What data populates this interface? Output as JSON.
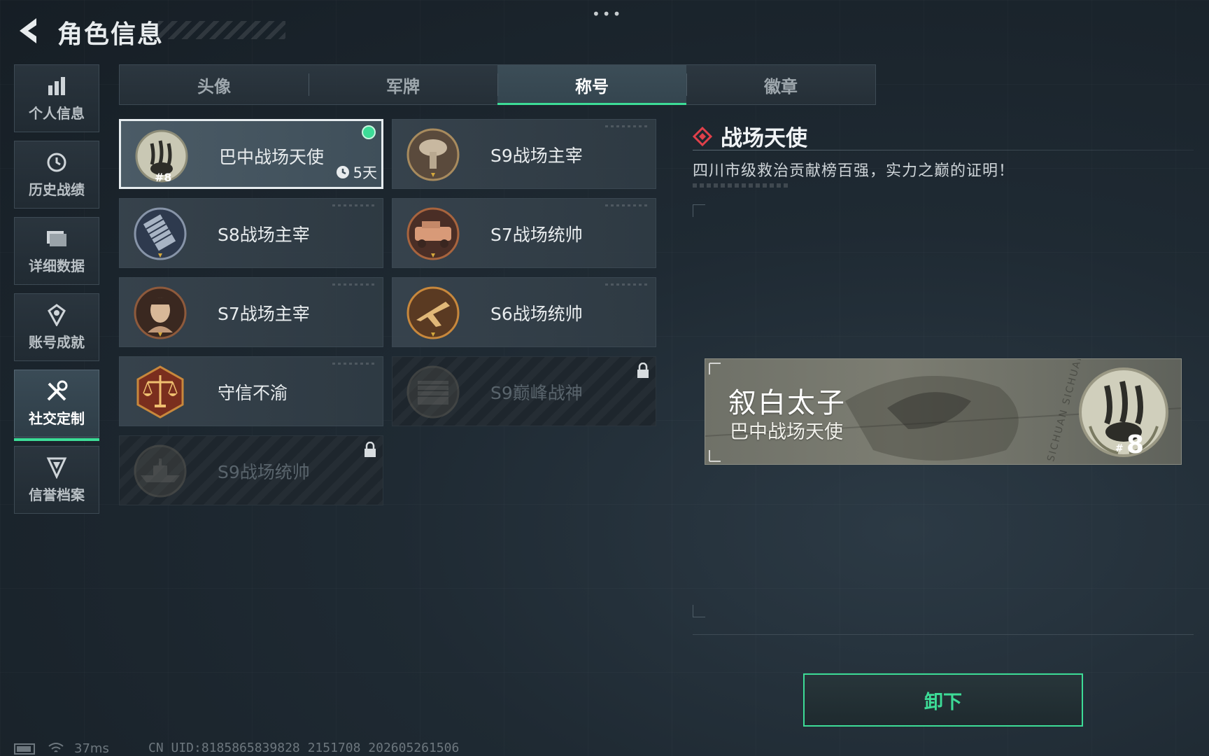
{
  "header": {
    "title": "角色信息"
  },
  "sidebar": {
    "items": [
      {
        "label": "个人信息",
        "icon": "bar-chart-icon"
      },
      {
        "label": "历史战绩",
        "icon": "history-clock-icon"
      },
      {
        "label": "详细数据",
        "icon": "folder-icon"
      },
      {
        "label": "账号成就",
        "icon": "achievement-icon"
      },
      {
        "label": "社交定制",
        "icon": "tools-icon",
        "active": true
      },
      {
        "label": "信誉档案",
        "icon": "shield-badge-icon"
      }
    ]
  },
  "tabs": [
    {
      "label": "头像"
    },
    {
      "label": "军牌"
    },
    {
      "label": "称号",
      "active": true
    },
    {
      "label": "徽章"
    }
  ],
  "titles": [
    {
      "name": "巴中战场天使",
      "selected": true,
      "equipped": true,
      "timer": "5天",
      "emblem": "sichuan-panda-emblem",
      "rank": "#8"
    },
    {
      "name": "S9战场主宰",
      "emblem": "mushroom-cloud-emblem"
    },
    {
      "name": "S8战场主宰",
      "emblem": "skyscraper-emblem"
    },
    {
      "name": "S7战场统帅",
      "emblem": "armored-vehicle-emblem"
    },
    {
      "name": "S7战场主宰",
      "emblem": "soldier-portrait-emblem"
    },
    {
      "name": "S6战场统帅",
      "emblem": "fighter-jet-emblem"
    },
    {
      "name": "守信不渝",
      "emblem": "scales-of-justice-emblem"
    },
    {
      "name": "S9巅峰战神",
      "emblem": "fortress-emblem",
      "locked": true
    },
    {
      "name": "S9战场统帅",
      "emblem": "warship-emblem",
      "locked": true
    }
  ],
  "detail": {
    "title": "战场天使",
    "description": "四川市级救治贡献榜百强，实力之巅的证明！"
  },
  "preview": {
    "player_name": "叙白太子",
    "title": "巴中战场天使",
    "rank": "8",
    "watermark": "SICHUAN SICHUAN"
  },
  "actions": {
    "unequip_label": "卸下"
  },
  "status": {
    "ping": "37ms",
    "uid": "CN UID:8185865839828 2151708 202605261506"
  },
  "colors": {
    "accent": "#3ddc97",
    "danger": "#e0404a",
    "bg": "#1f2a33"
  }
}
